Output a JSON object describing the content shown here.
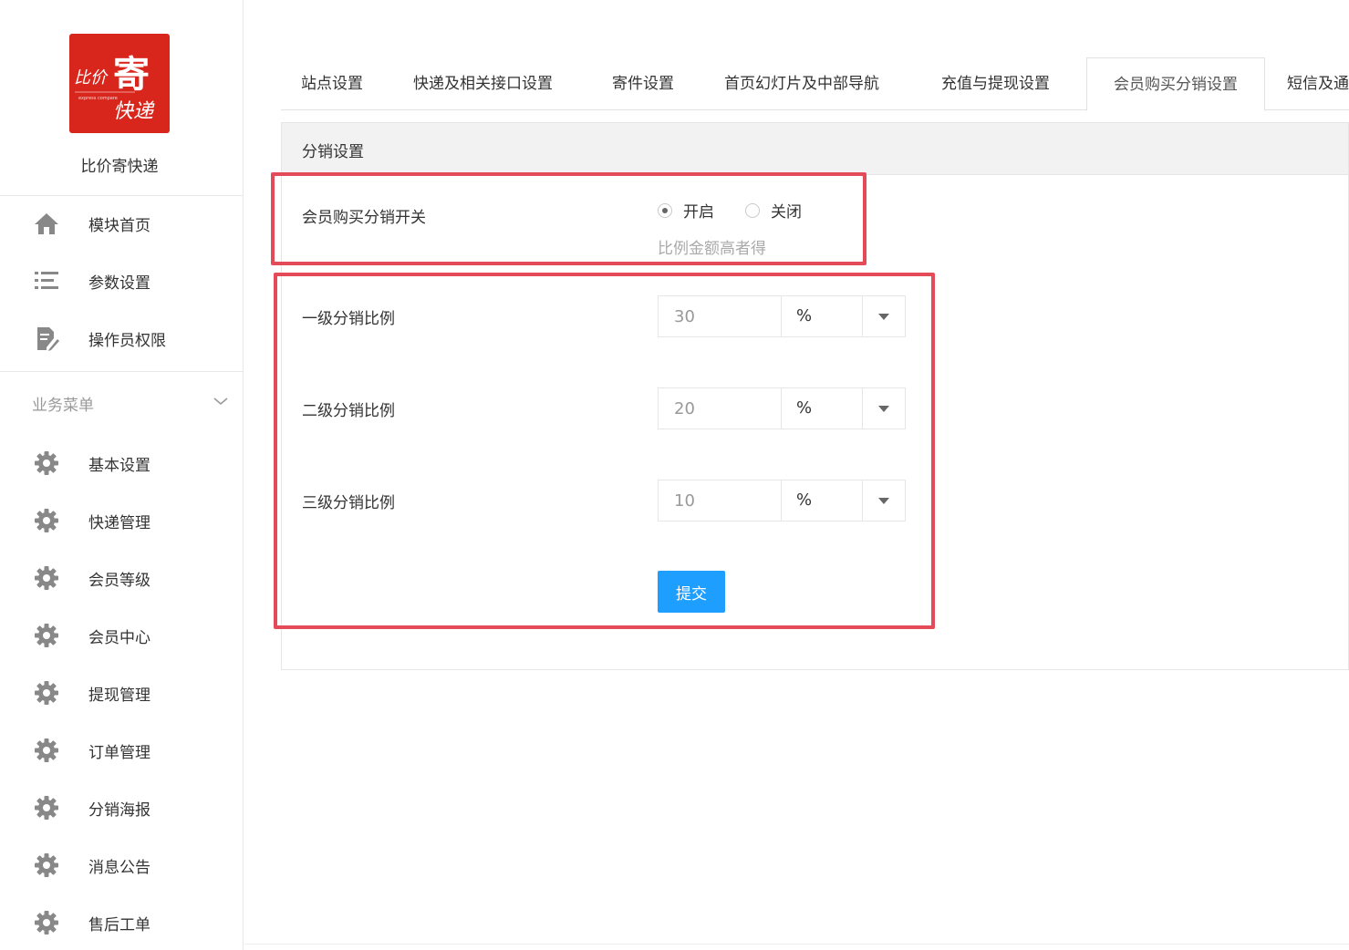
{
  "sidebar": {
    "logo": {
      "line1": "比价",
      "line2": "寄",
      "line3": "快递",
      "subline": "express compare"
    },
    "site_name": "比价寄快递",
    "top_items": [
      {
        "label": "模块首页",
        "icon": "home-icon"
      },
      {
        "label": "参数设置",
        "icon": "list-icon"
      },
      {
        "label": "操作员权限",
        "icon": "document-edit-icon"
      }
    ],
    "section": {
      "label": "业务菜单",
      "icon": "chevron-down-icon"
    },
    "menu_items": [
      {
        "label": "基本设置",
        "icon": "gear-icon"
      },
      {
        "label": "快递管理",
        "icon": "gear-icon"
      },
      {
        "label": "会员等级",
        "icon": "gear-icon"
      },
      {
        "label": "会员中心",
        "icon": "gear-icon"
      },
      {
        "label": "提现管理",
        "icon": "gear-icon"
      },
      {
        "label": "订单管理",
        "icon": "gear-icon"
      },
      {
        "label": "分销海报",
        "icon": "gear-icon"
      },
      {
        "label": "消息公告",
        "icon": "gear-icon"
      },
      {
        "label": "售后工单",
        "icon": "gear-icon"
      }
    ]
  },
  "tabs": [
    {
      "label": "站点设置",
      "active": false
    },
    {
      "label": "快递及相关接口设置",
      "active": false
    },
    {
      "label": "寄件设置",
      "active": false
    },
    {
      "label": "首页幻灯片及中部导航",
      "active": false
    },
    {
      "label": "充值与提现设置",
      "active": false
    },
    {
      "label": "会员购买分销设置",
      "active": true
    },
    {
      "label": "短信及通",
      "active": false
    }
  ],
  "panel": {
    "title": "分销设置",
    "switch": {
      "label": "会员购买分销开关",
      "options": [
        {
          "label": "开启",
          "checked": true
        },
        {
          "label": "关闭",
          "checked": false
        }
      ],
      "hint": "比例金额高者得"
    },
    "rates": [
      {
        "label": "一级分销比例",
        "value": "30",
        "unit": "%"
      },
      {
        "label": "二级分销比例",
        "value": "20",
        "unit": "%"
      },
      {
        "label": "三级分销比例",
        "value": "10",
        "unit": "%"
      }
    ],
    "submit_label": "提交"
  },
  "colors": {
    "brand_red": "#d9261c",
    "primary_button": "#1e9fff",
    "annotation_red": "#e54a58",
    "icon_gray": "#888888"
  }
}
